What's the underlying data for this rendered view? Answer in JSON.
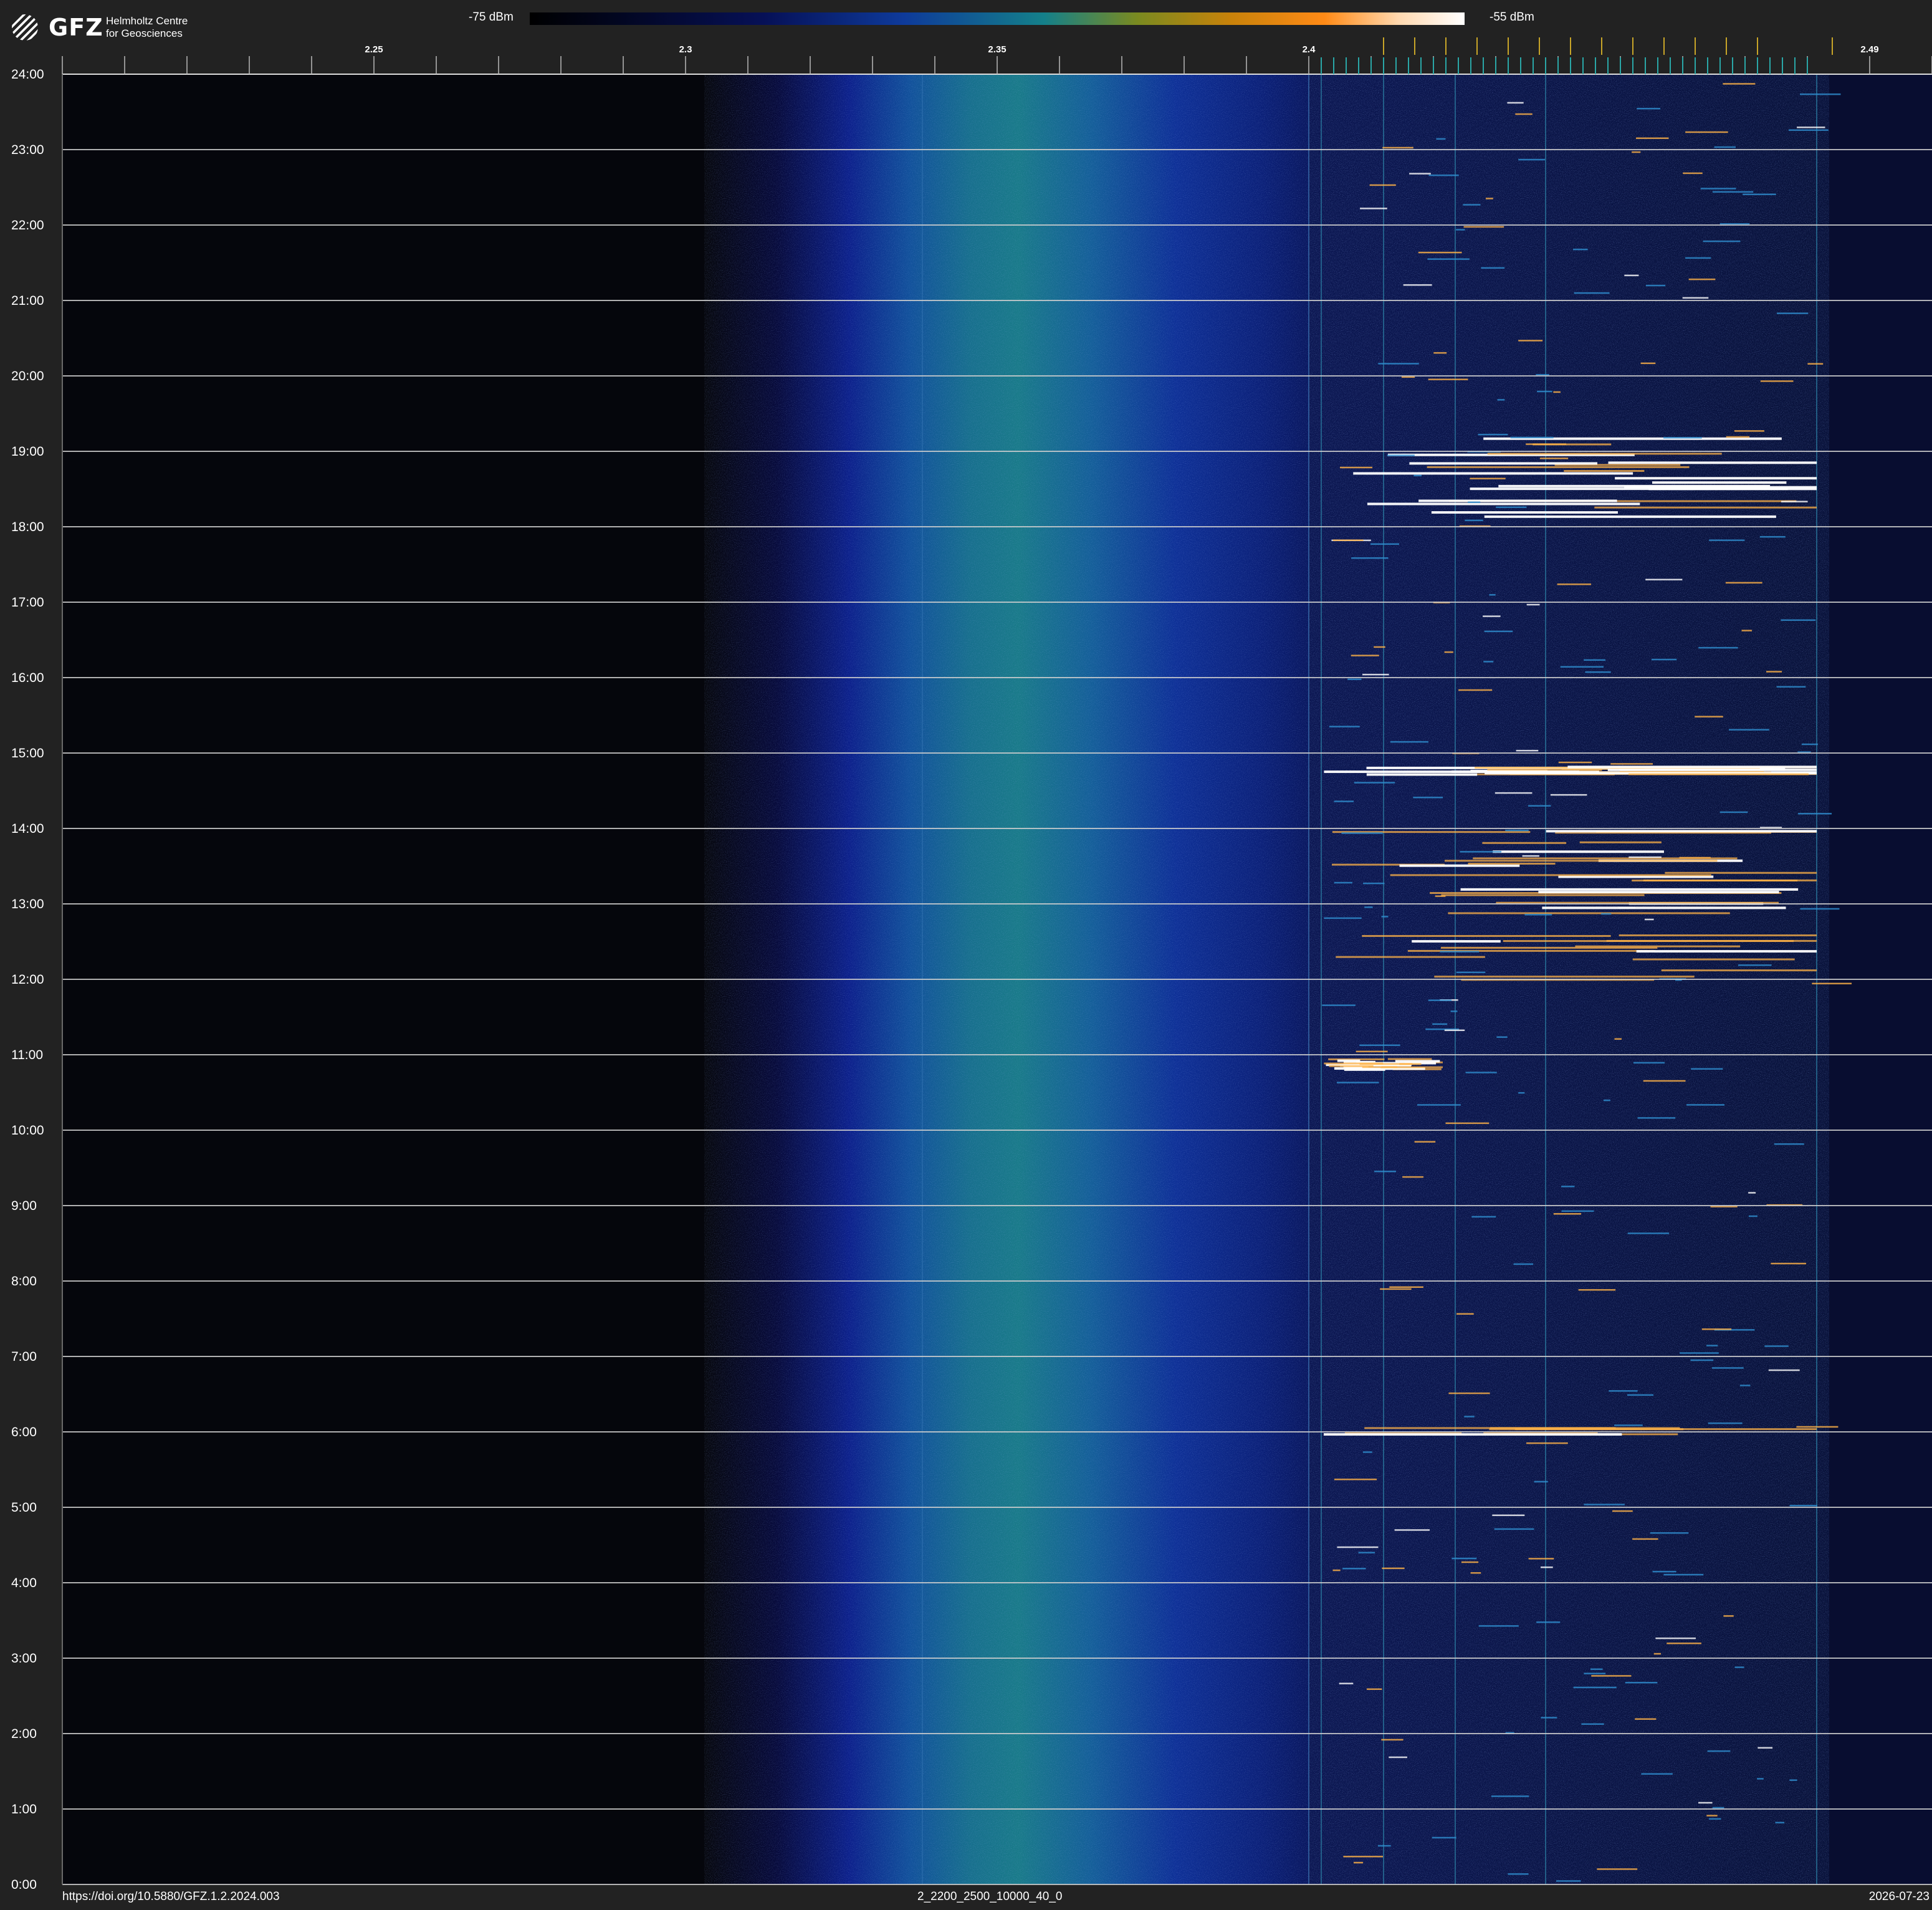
{
  "logo": {
    "text": "GFZ",
    "subtitle_line1": "Helmholtz Centre",
    "subtitle_line2": "for Geosciences"
  },
  "colorbar": {
    "min_label": "-75 dBm",
    "max_label": "-55 dBm"
  },
  "footer": {
    "doi": "https://doi.org/10.5880/GFZ.1.2.2024.003",
    "file_id": "2_2200_2500_10000_40_0",
    "date": "2026-07-23"
  },
  "colors": {
    "background": "#222222",
    "plot_background": "#05060c",
    "gridline": "#cfcfcf",
    "cyan_marker": "#2aa7a7",
    "yellow_marker": "#c8a528",
    "signal_hot": "#ffffff",
    "signal_warm": "#ffb347"
  },
  "chart_data": {
    "type": "heatmap",
    "x_unit": "GHz",
    "xlim": [
      2.2,
      2.5
    ],
    "x_tick_labels": [
      {
        "value": 2.25,
        "label": "2.25"
      },
      {
        "value": 2.3,
        "label": "2.3"
      },
      {
        "value": 2.35,
        "label": "2.35"
      },
      {
        "value": 2.4,
        "label": "2.4"
      },
      {
        "value": 2.49,
        "label": "2.49"
      }
    ],
    "x_minor_step": 0.01,
    "y_unit": "hours",
    "ylim": [
      0,
      24
    ],
    "y_tick_labels": [
      "0:00",
      "1:00",
      "2:00",
      "3:00",
      "4:00",
      "5:00",
      "6:00",
      "7:00",
      "8:00",
      "9:00",
      "10:00",
      "11:00",
      "12:00",
      "13:00",
      "14:00",
      "15:00",
      "16:00",
      "17:00",
      "18:00",
      "19:00",
      "20:00",
      "21:00",
      "22:00",
      "23:00",
      "24:00"
    ],
    "color_scale": {
      "min_dBm": -75,
      "max_dBm": -55
    },
    "broadband_noise_band": {
      "x_start": 2.303,
      "x_peak_start": 2.325,
      "x_peak_end": 2.355,
      "x_end": 2.4
    },
    "ism_band": {
      "x_start": 2.4,
      "x_end": 2.4835
    },
    "channel_markers_cyan": [
      2.402,
      2.404,
      2.406,
      2.408,
      2.41,
      2.412,
      2.414,
      2.416,
      2.418,
      2.42,
      2.422,
      2.424,
      2.426,
      2.428,
      2.43,
      2.432,
      2.434,
      2.436,
      2.438,
      2.44,
      2.442,
      2.444,
      2.446,
      2.448,
      2.45,
      2.452,
      2.454,
      2.456,
      2.458,
      2.46,
      2.462,
      2.464,
      2.466,
      2.468,
      2.47,
      2.472,
      2.474,
      2.476,
      2.478,
      2.48
    ],
    "channel_markers_yellow": [
      2.412,
      2.417,
      2.422,
      2.427,
      2.432,
      2.437,
      2.442,
      2.447,
      2.452,
      2.457,
      2.462,
      2.467,
      2.472,
      2.484
    ],
    "strong_interference_periods": [
      {
        "t_start": 18.0,
        "t_end": 19.2,
        "x_start": 2.402,
        "x_end": 2.4815,
        "level": "high"
      },
      {
        "t_start": 14.7,
        "t_end": 14.85,
        "x_start": 2.402,
        "x_end": 2.4815,
        "level": "high"
      },
      {
        "t_start": 11.9,
        "t_end": 14.0,
        "x_start": 2.402,
        "x_end": 2.4815,
        "level": "medium"
      },
      {
        "t_start": 10.8,
        "t_end": 10.95,
        "x_start": 2.402,
        "x_end": 2.4215,
        "level": "high"
      },
      {
        "t_start": 5.95,
        "t_end": 6.05,
        "x_start": 2.402,
        "x_end": 2.4815,
        "level": "low"
      }
    ]
  }
}
